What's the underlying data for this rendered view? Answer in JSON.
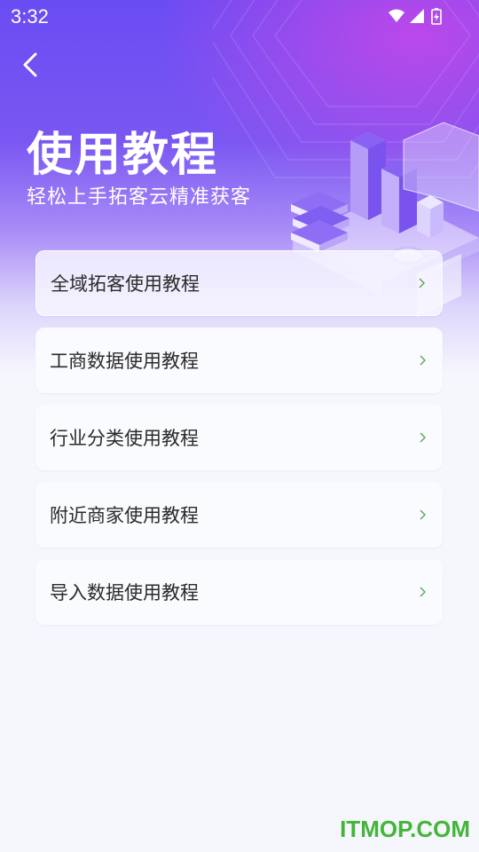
{
  "status_bar": {
    "time": "3:32"
  },
  "header": {
    "title": "使用教程",
    "subtitle": "轻松上手拓客云精准获客"
  },
  "menu": {
    "items": [
      {
        "label": "全域拓客使用教程"
      },
      {
        "label": "工商数据使用教程"
      },
      {
        "label": "行业分类使用教程"
      },
      {
        "label": "附近商家使用教程"
      },
      {
        "label": "导入数据使用教程"
      }
    ]
  },
  "watermark": "ITMOP.COM",
  "colors": {
    "accent": "#6a4cf3",
    "chevron": "#5aa35a",
    "watermark": "#43b638"
  },
  "icons": [
    "back-arrow-icon",
    "wifi-icon",
    "signal-icon",
    "battery-icon",
    "chevron-right-icon"
  ]
}
